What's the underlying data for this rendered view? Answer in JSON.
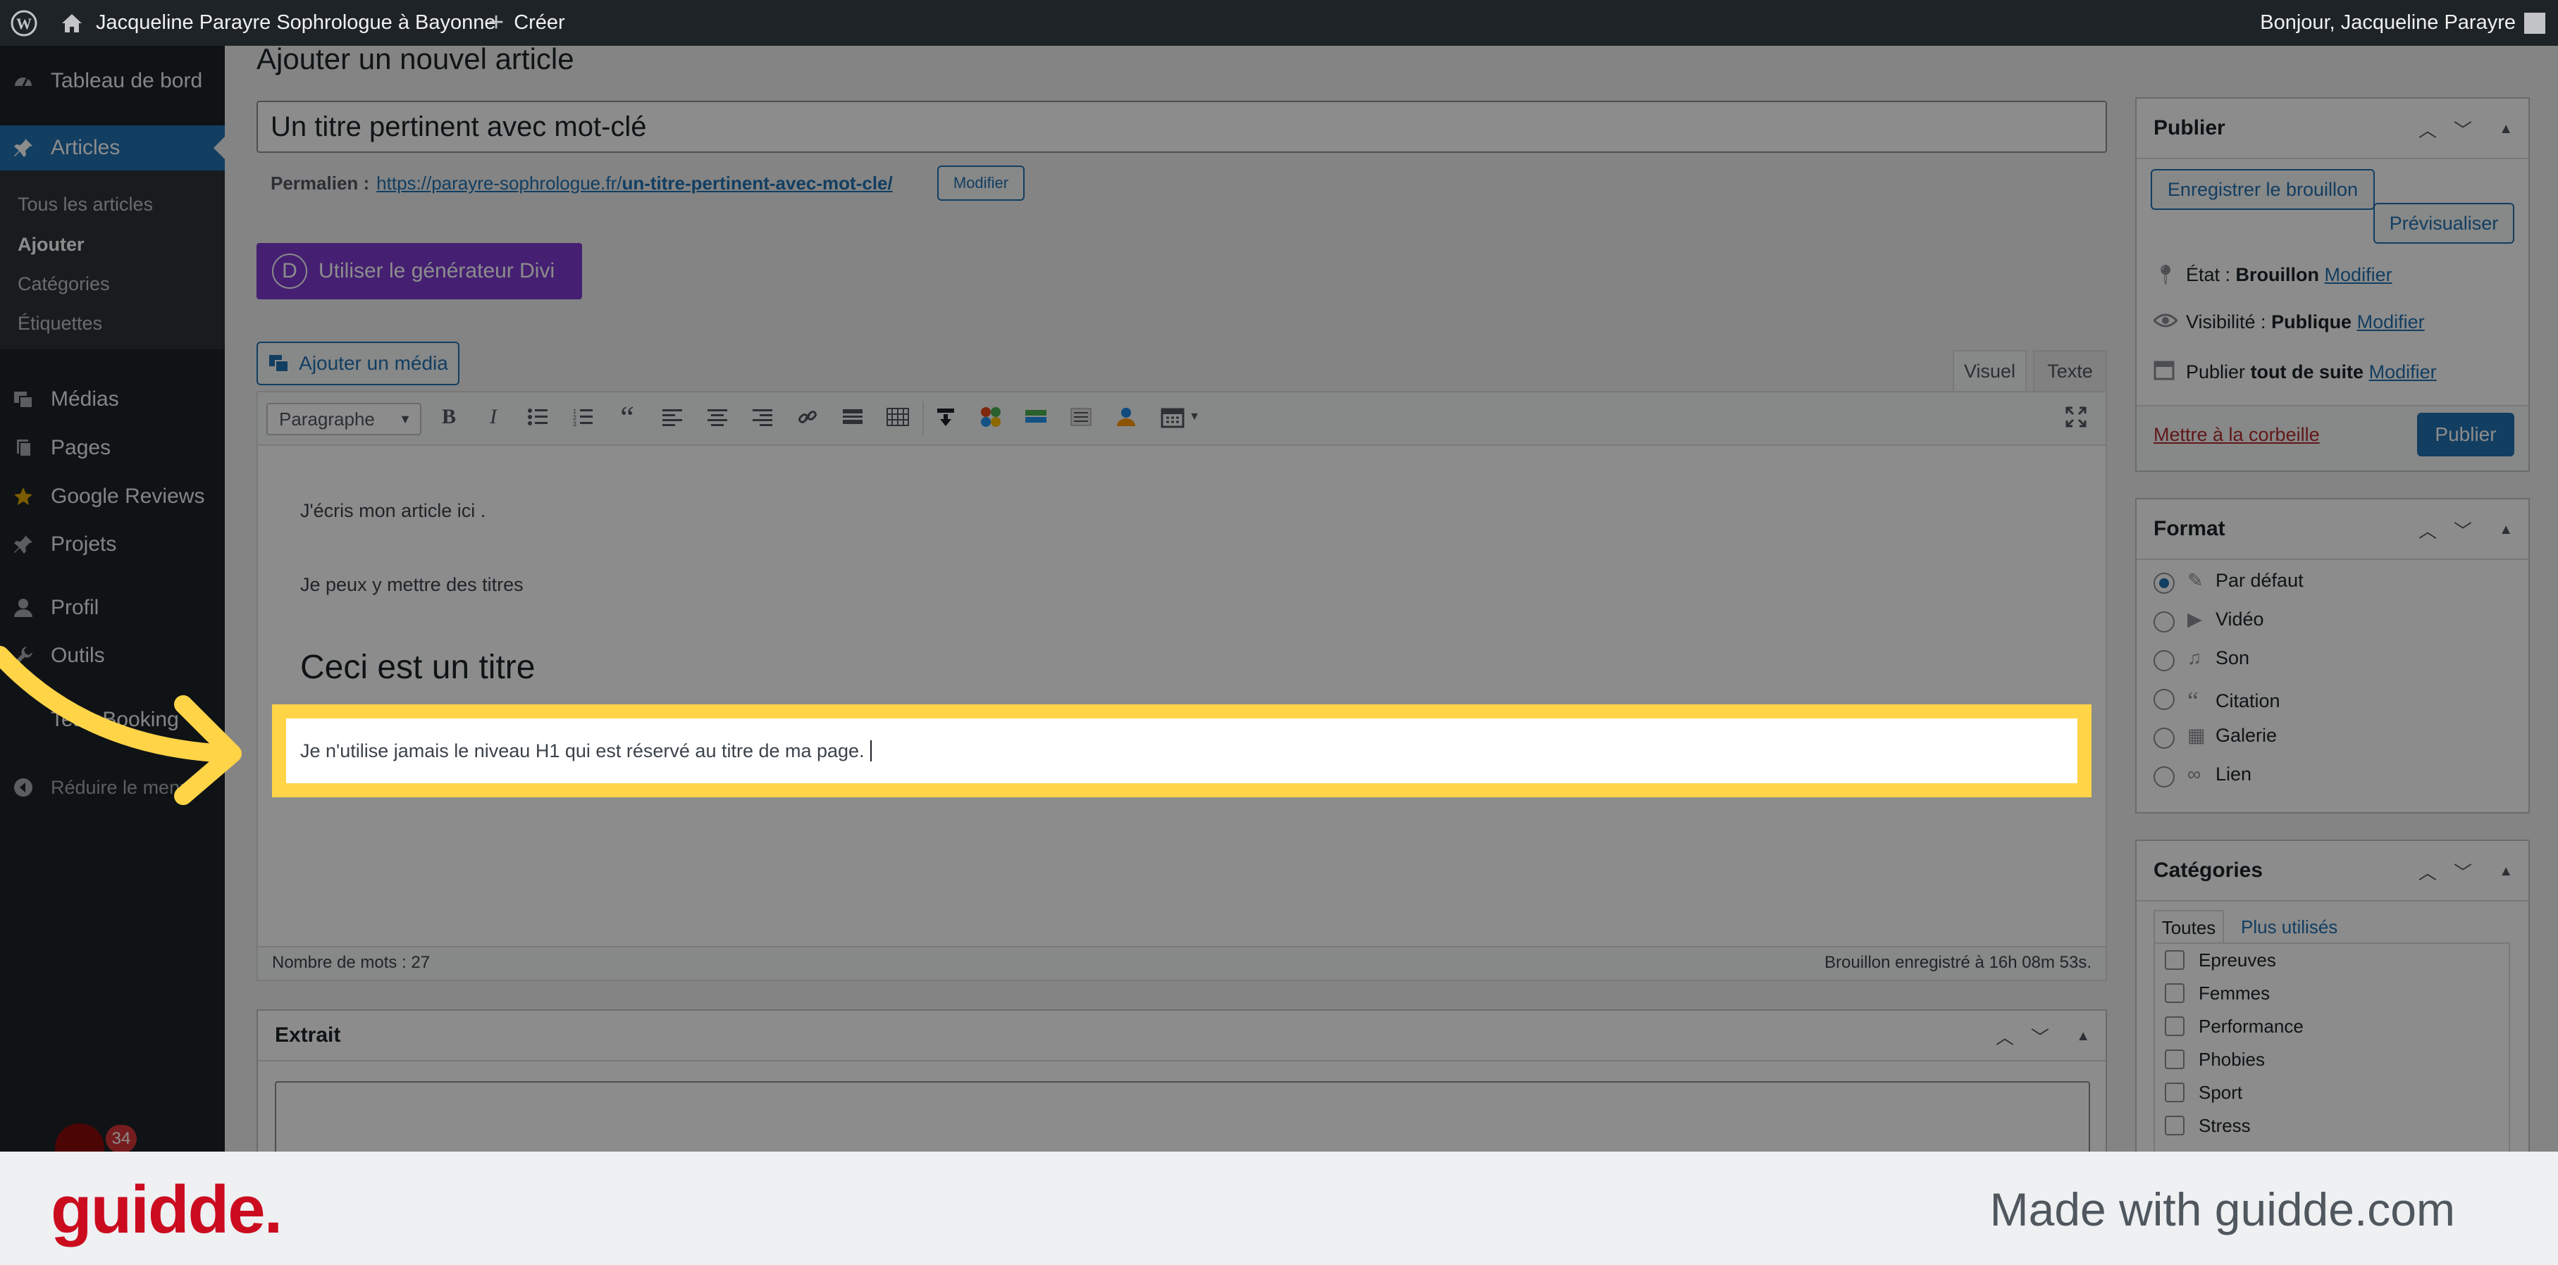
{
  "adminbar": {
    "site_title": "Jacqueline Parayre Sophrologue à Bayonne",
    "new_label": "Créer",
    "greeting": "Bonjour, Jacqueline Parayre"
  },
  "menu": {
    "dashboard": "Tableau de bord",
    "articles": "Articles",
    "submenu": [
      "Tous les articles",
      "Ajouter",
      "Catégories",
      "Étiquettes"
    ],
    "medias": "Médias",
    "pages": "Pages",
    "google_reviews": "Google Reviews",
    "projets": "Projets",
    "profil": "Profil",
    "outils": "Outils",
    "teambooking": "TeamBooking",
    "collapse": "Réduire le menu",
    "badge": "34"
  },
  "page": {
    "heading": "Ajouter un nouvel article",
    "title_value": "Un titre pertinent avec mot-clé",
    "permalink_label": "Permalien :",
    "permalink_base": "https://parayre-sophrologue.fr/",
    "permalink_slug": "un-titre-pertinent-avec-mot-cle/",
    "permalink_edit": "Modifier",
    "divi_button": "Utiliser le générateur Divi",
    "add_media": "Ajouter un média",
    "tab_visual": "Visuel",
    "tab_text": "Texte",
    "format_select": "Paragraphe"
  },
  "editor": {
    "p1": "J'écris mon article ici .",
    "p2": "Je peux y mettre des titres",
    "h2": "Ceci est un titre",
    "p3": "Je n'utilise jamais le niveau H1 qui est réservé au titre de ma page.",
    "word_count": "Nombre de mots : 27",
    "saved_status": "Brouillon enregistré à 16h 08m 53s."
  },
  "excerpt": {
    "title": "Extrait"
  },
  "publish": {
    "title": "Publier",
    "save_draft": "Enregistrer le brouillon",
    "preview": "Prévisualiser",
    "state_label": "État :",
    "state_value": "Brouillon",
    "visibility_label": "Visibilité :",
    "visibility_value": "Publique",
    "publish_label": "Publier",
    "publish_value": "tout de suite",
    "edit": "Modifier",
    "trash": "Mettre à la corbeille",
    "publish_button": "Publier"
  },
  "format": {
    "title": "Format",
    "options": [
      "Par défaut",
      "Vidéo",
      "Son",
      "Citation",
      "Galerie",
      "Lien"
    ]
  },
  "categories": {
    "title": "Catégories",
    "tab_all": "Toutes",
    "tab_popular": "Plus utilisés",
    "items": [
      "Epreuves",
      "Femmes",
      "Performance",
      "Phobies",
      "Sport",
      "Stress"
    ]
  },
  "footer": {
    "logo": "guidde.",
    "made_with": "Made with guidde.com"
  },
  "colors": {
    "highlight": "#ffd447",
    "accent": "#2271b1",
    "divi": "#7e3bd0",
    "guidde_red": "#cb0c1f"
  }
}
